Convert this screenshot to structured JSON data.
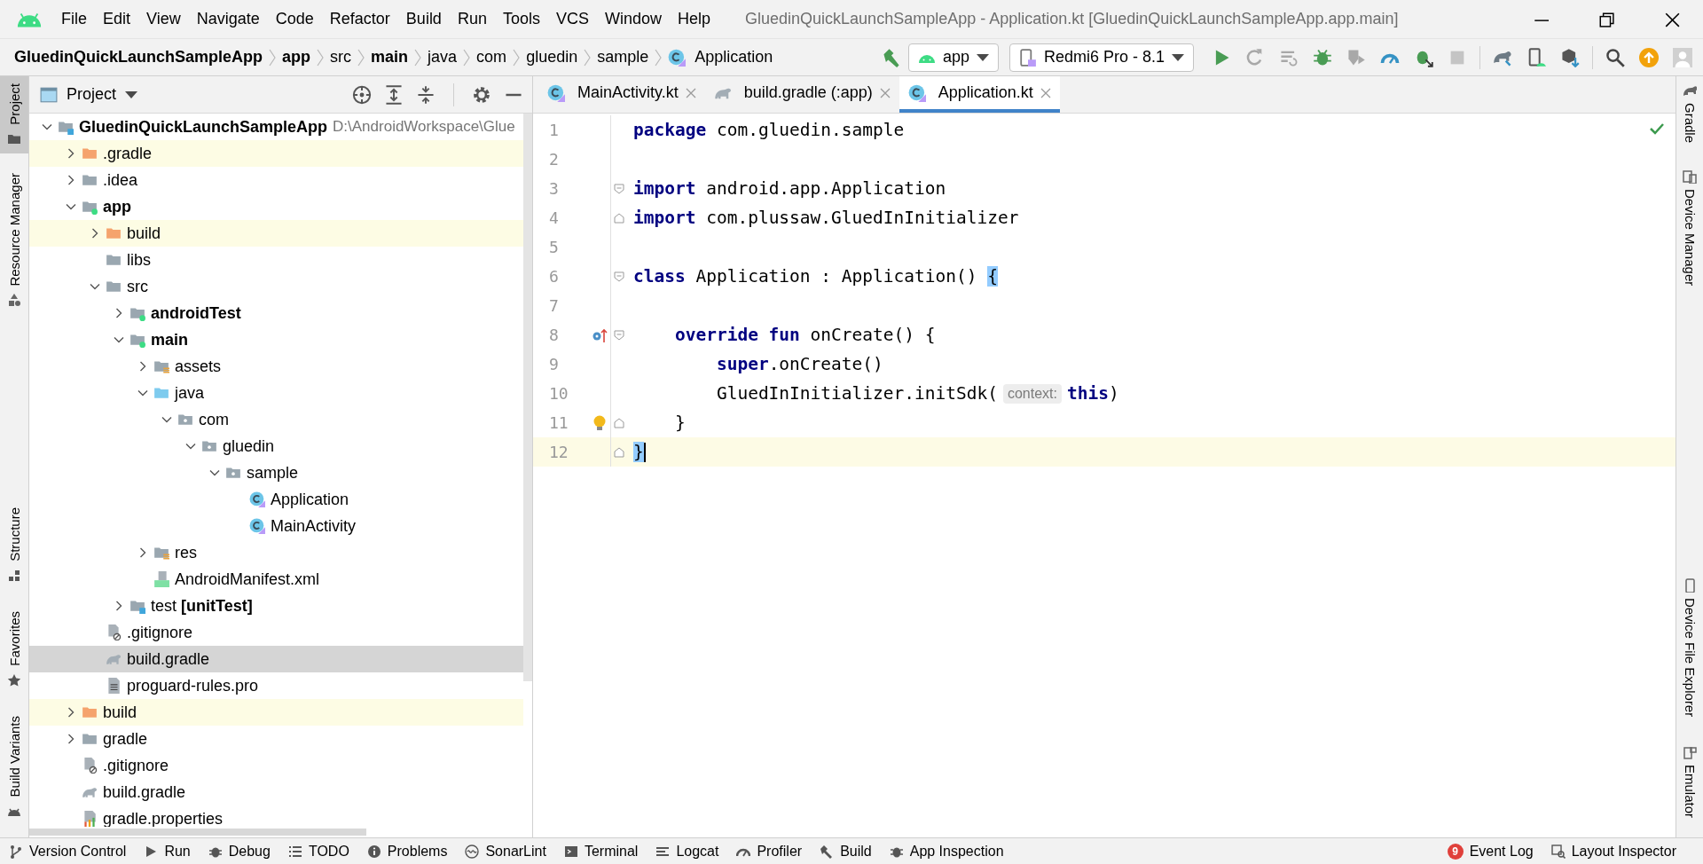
{
  "menu_bar": {
    "items": [
      "File",
      "Edit",
      "View",
      "Navigate",
      "Code",
      "Refactor",
      "Build",
      "Run",
      "Tools",
      "VCS",
      "Window",
      "Help"
    ],
    "window_title": "GluedinQuickLaunchSampleApp - Application.kt [GluedinQuickLaunchSampleApp.app.main]"
  },
  "nav_bar": {
    "breadcrumbs": [
      {
        "label": "GluedinQuickLaunchSampleApp",
        "bold": true
      },
      {
        "label": "app",
        "bold": true
      },
      {
        "label": "src",
        "bold": false
      },
      {
        "label": "main",
        "bold": true
      },
      {
        "label": "java",
        "bold": false
      },
      {
        "label": "com",
        "bold": false
      },
      {
        "label": "gluedin",
        "bold": false
      },
      {
        "label": "sample",
        "bold": false
      },
      {
        "label": "Application",
        "bold": false,
        "kind": "class"
      }
    ],
    "run_config": "app",
    "device": "Redmi6 Pro - 8.1"
  },
  "left_tool_windows": {
    "top": [
      {
        "label": "Project",
        "selected": true
      },
      {
        "label": "Resource Manager",
        "selected": false
      }
    ],
    "bottom": [
      {
        "label": "Structure",
        "selected": false
      },
      {
        "label": "Favorites",
        "selected": false
      },
      {
        "label": "Build Variants",
        "selected": false
      }
    ]
  },
  "project_panel": {
    "title": "Project",
    "tree": [
      {
        "label": "GluedinQuickLaunchSampleApp",
        "bold": true,
        "hint": "D:\\AndroidWorkspace\\Glue",
        "kind": "root-module",
        "expanded": true,
        "selected": false,
        "highlighted": false,
        "children": [
          {
            "label": ".gradle",
            "kind": "excluded",
            "expanded": false,
            "selected": false,
            "highlighted": true
          },
          {
            "label": ".idea",
            "kind": "folder",
            "expanded": false,
            "selected": false,
            "highlighted": false
          },
          {
            "label": "app",
            "bold": true,
            "kind": "module",
            "expanded": true,
            "selected": false,
            "highlighted": false,
            "children": [
              {
                "label": "build",
                "kind": "excluded",
                "expanded": false,
                "selected": false,
                "highlighted": true
              },
              {
                "label": "libs",
                "kind": "folder",
                "selected": false,
                "highlighted": false
              },
              {
                "label": "src",
                "kind": "folder",
                "expanded": true,
                "selected": false,
                "highlighted": false,
                "children": [
                  {
                    "label": "androidTest",
                    "bold": true,
                    "kind": "module",
                    "expanded": false,
                    "selected": false,
                    "highlighted": false
                  },
                  {
                    "label": "main",
                    "bold": true,
                    "kind": "module",
                    "expanded": true,
                    "selected": false,
                    "highlighted": false,
                    "children": [
                      {
                        "label": "assets",
                        "kind": "resources",
                        "expanded": false,
                        "selected": false,
                        "highlighted": false
                      },
                      {
                        "label": "java",
                        "kind": "source-root",
                        "expanded": true,
                        "selected": false,
                        "highlighted": false,
                        "children": [
                          {
                            "label": "com",
                            "kind": "package",
                            "expanded": true,
                            "selected": false,
                            "highlighted": false,
                            "children": [
                              {
                                "label": "gluedin",
                                "kind": "package",
                                "expanded": true,
                                "selected": false,
                                "highlighted": false,
                                "children": [
                                  {
                                    "label": "sample",
                                    "kind": "package",
                                    "expanded": true,
                                    "selected": false,
                                    "highlighted": false,
                                    "children": [
                                      {
                                        "label": "Application",
                                        "kind": "class",
                                        "selected": false,
                                        "highlighted": false
                                      },
                                      {
                                        "label": "MainActivity",
                                        "kind": "class",
                                        "selected": false,
                                        "highlighted": false
                                      }
                                    ]
                                  }
                                ]
                              }
                            ]
                          }
                        ]
                      },
                      {
                        "label": "res",
                        "kind": "resources",
                        "expanded": false,
                        "selected": false,
                        "highlighted": false
                      },
                      {
                        "label": "AndroidManifest.xml",
                        "kind": "manifest",
                        "selected": false,
                        "highlighted": false
                      }
                    ]
                  },
                  {
                    "label": "test **[unitTest]**",
                    "kind": "test-module",
                    "expanded": false,
                    "selected": false,
                    "highlighted": false
                  }
                ]
              },
              {
                "label": ".gitignore",
                "kind": "ignore-file",
                "selected": false,
                "highlighted": false
              },
              {
                "label": "build.gradle",
                "kind": "gradle",
                "selected": true,
                "highlighted": false
              },
              {
                "label": "proguard-rules.pro",
                "kind": "text-file",
                "selected": false,
                "highlighted": false
              }
            ]
          },
          {
            "label": "build",
            "kind": "excluded",
            "expanded": false,
            "selected": false,
            "highlighted": true
          },
          {
            "label": "gradle",
            "kind": "folder",
            "expanded": false,
            "selected": false,
            "highlighted": false
          },
          {
            "label": ".gitignore",
            "kind": "ignore-file",
            "selected": false,
            "highlighted": false
          },
          {
            "label": "build.gradle",
            "kind": "gradle",
            "selected": false,
            "highlighted": false
          },
          {
            "label": "gradle.properties",
            "kind": "properties",
            "selected": false,
            "highlighted": false
          }
        ]
      }
    ]
  },
  "editor": {
    "tabs": [
      {
        "label": "MainActivity.kt",
        "kind": "class",
        "selected": false
      },
      {
        "label": "build.gradle (:app)",
        "kind": "gradle",
        "selected": false
      },
      {
        "label": "Application.kt",
        "kind": "class",
        "selected": true
      }
    ],
    "lines": [
      {
        "number": "1",
        "current": false,
        "tokens": [
          {
            "kind": "keyword",
            "text": "package"
          },
          {
            "kind": "plain",
            "text": " com.gluedin.sample"
          }
        ]
      },
      {
        "number": "2",
        "current": false
      },
      {
        "number": "3",
        "current": false,
        "fold_start": true,
        "tokens": [
          {
            "kind": "keyword",
            "text": "import"
          },
          {
            "kind": "plain",
            "text": " android.app.Application"
          }
        ]
      },
      {
        "number": "4",
        "current": false,
        "fold_end": true,
        "tokens": [
          {
            "kind": "keyword",
            "text": "import"
          },
          {
            "kind": "plain",
            "text": " com.plussaw.GluedInInitializer"
          }
        ]
      },
      {
        "number": "5",
        "current": false
      },
      {
        "number": "6",
        "current": false,
        "fold_start": true,
        "tokens": [
          {
            "kind": "keyword",
            "text": "class"
          },
          {
            "kind": "plain",
            "text": " Application : Application() "
          },
          {
            "kind": "brace-match",
            "text": "{"
          }
        ]
      },
      {
        "number": "7",
        "current": false
      },
      {
        "number": "8",
        "current": false,
        "fold_start": true,
        "override_marker": true,
        "tokens": [
          {
            "kind": "keyword",
            "text": "    override fun"
          },
          {
            "kind": "plain",
            "text": " onCreate() {"
          }
        ]
      },
      {
        "number": "9",
        "current": false,
        "tokens": [
          {
            "kind": "keyword",
            "text": "        super"
          },
          {
            "kind": "plain",
            "text": ".onCreate()"
          }
        ]
      },
      {
        "number": "10",
        "current": false,
        "tokens": [
          {
            "kind": "plain",
            "text": "        GluedInInitializer.initSdk("
          },
          {
            "kind": "hint",
            "text": "context:"
          },
          {
            "kind": "keyword",
            "text": "this"
          },
          {
            "kind": "plain",
            "text": ")"
          }
        ]
      },
      {
        "number": "11",
        "current": false,
        "fold_end": true,
        "bulb": true,
        "tokens": [
          {
            "kind": "plain",
            "text": "    }"
          }
        ]
      },
      {
        "number": "12",
        "current": true,
        "fold_end": true,
        "tokens": [
          {
            "kind": "brace-match",
            "text": "}"
          }
        ]
      }
    ]
  },
  "right_tool_windows": {
    "top": [
      {
        "label": "Gradle"
      },
      {
        "label": "Device Manager"
      }
    ],
    "bottom": [
      {
        "label": "Device File Explorer"
      },
      {
        "label": "Emulator"
      }
    ]
  },
  "bottom_bar": {
    "tools": [
      {
        "label": "Version Control"
      },
      {
        "label": "Run"
      },
      {
        "label": "Debug"
      },
      {
        "label": "TODO"
      },
      {
        "label": "Problems"
      },
      {
        "label": "SonarLint"
      },
      {
        "label": "Terminal"
      },
      {
        "label": "Logcat"
      },
      {
        "label": "Profiler"
      },
      {
        "label": "Build"
      },
      {
        "label": "App Inspection"
      }
    ],
    "right_tools": [
      {
        "label": "Event Log",
        "badge": "9"
      },
      {
        "label": "Layout Inspector"
      }
    ]
  }
}
